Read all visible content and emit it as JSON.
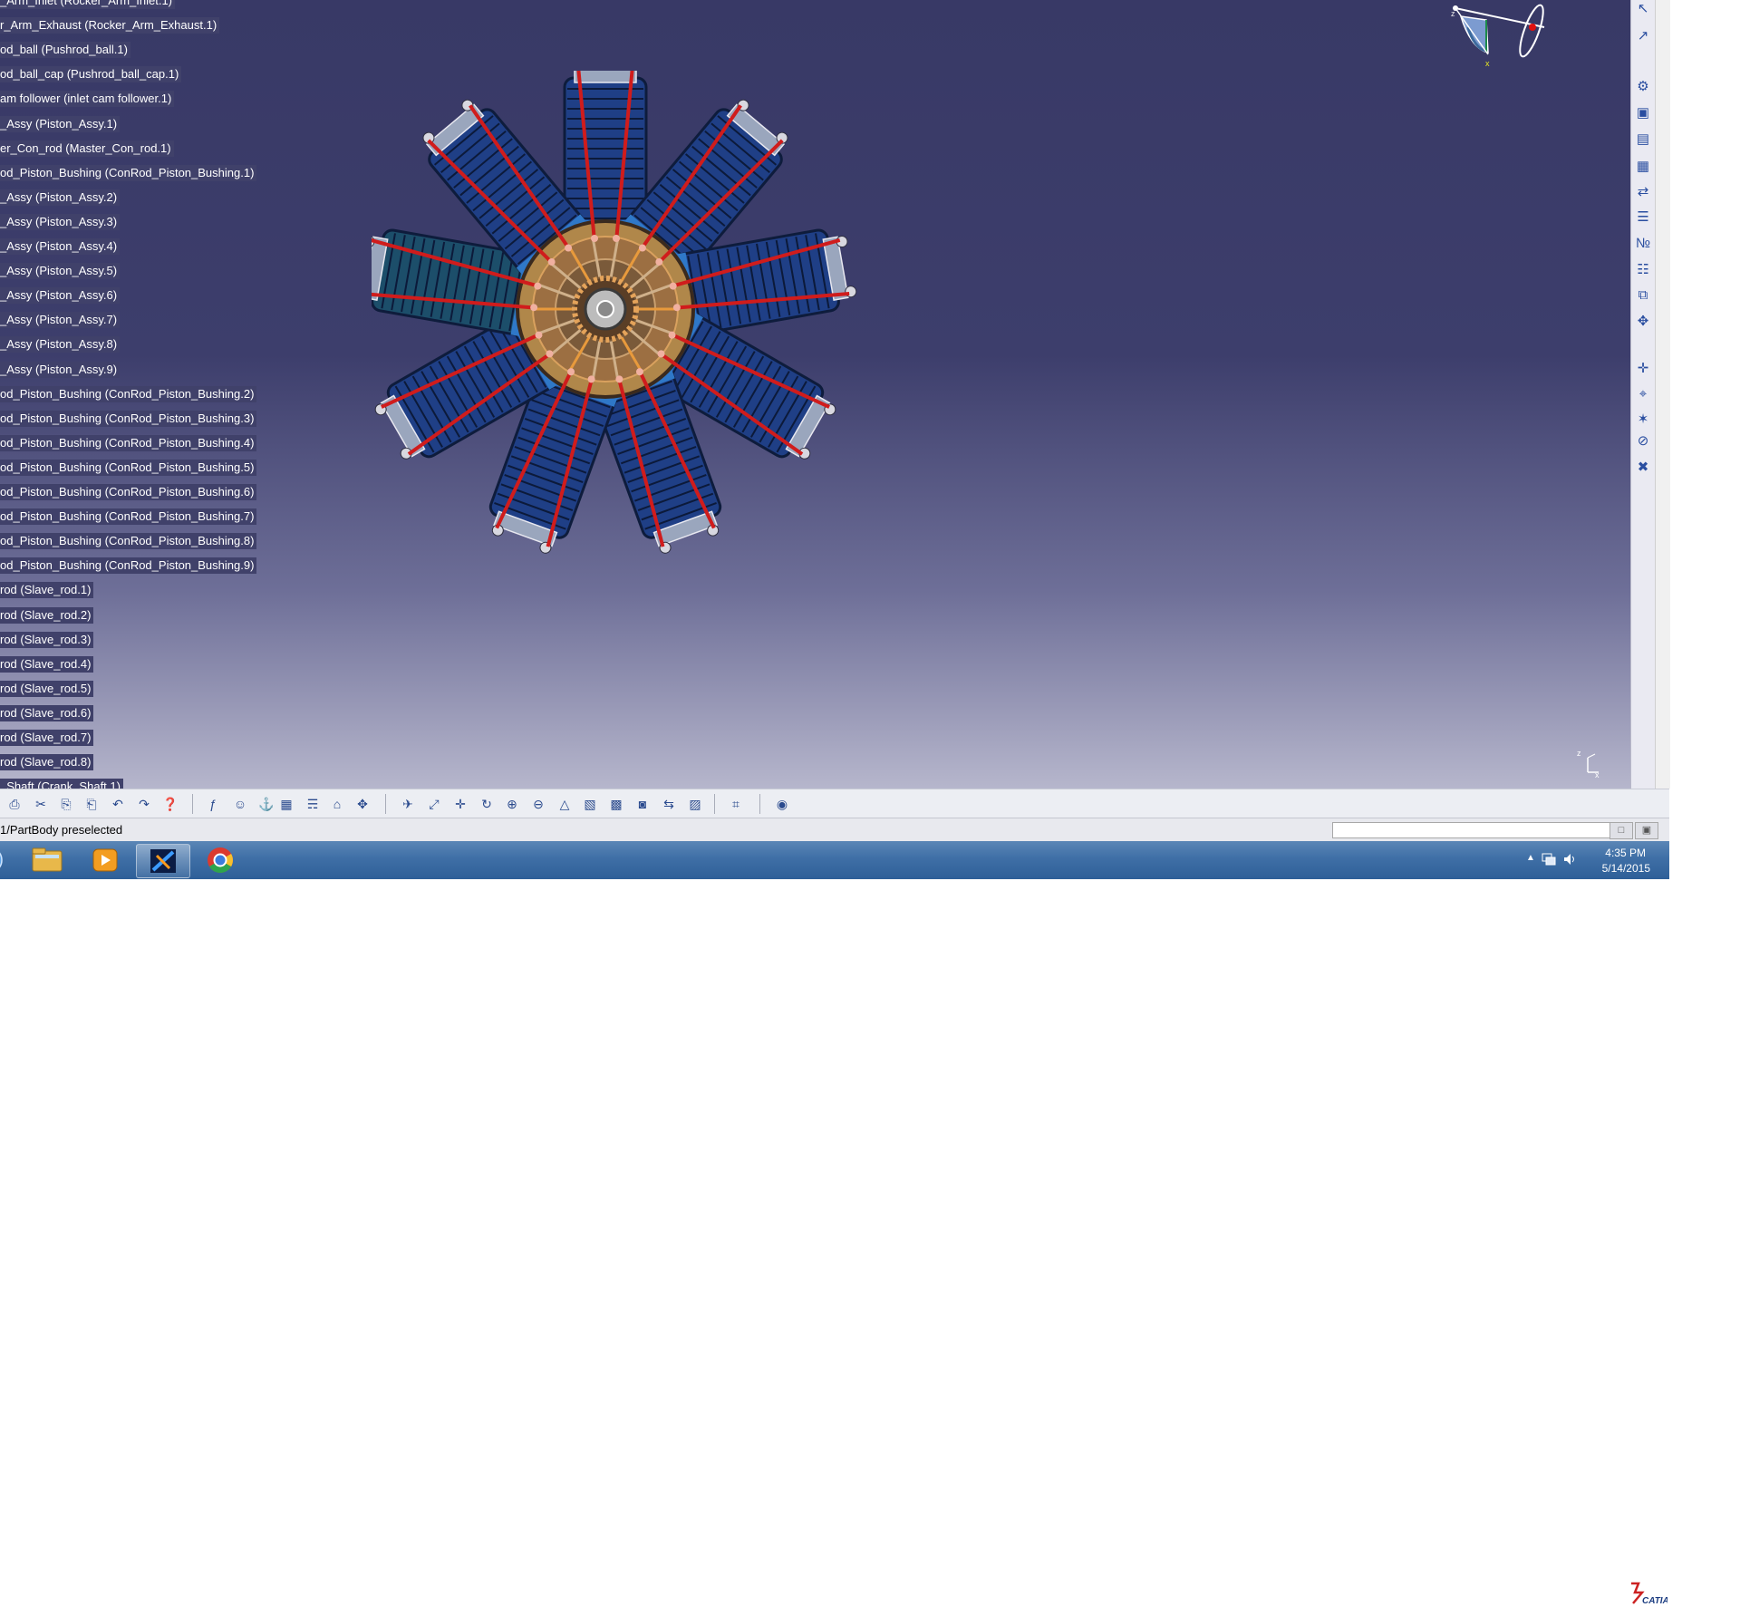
{
  "tree": {
    "items": [
      "_Arm_Inlet (Rocker_Arm_Inlet.1)",
      "r_Arm_Exhaust (Rocker_Arm_Exhaust.1)",
      "od_ball (Pushrod_ball.1)",
      "od_ball_cap (Pushrod_ball_cap.1)",
      "am follower (inlet cam follower.1)",
      "_Assy (Piston_Assy.1)",
      "er_Con_rod (Master_Con_rod.1)",
      "od_Piston_Bushing (ConRod_Piston_Bushing.1)",
      "_Assy (Piston_Assy.2)",
      "_Assy (Piston_Assy.3)",
      "_Assy (Piston_Assy.4)",
      "_Assy (Piston_Assy.5)",
      "_Assy (Piston_Assy.6)",
      "_Assy (Piston_Assy.7)",
      "_Assy (Piston_Assy.8)",
      "_Assy (Piston_Assy.9)",
      "od_Piston_Bushing (ConRod_Piston_Bushing.2)",
      "od_Piston_Bushing (ConRod_Piston_Bushing.3)",
      "od_Piston_Bushing (ConRod_Piston_Bushing.4)",
      "od_Piston_Bushing (ConRod_Piston_Bushing.5)",
      "od_Piston_Bushing (ConRod_Piston_Bushing.6)",
      "od_Piston_Bushing (ConRod_Piston_Bushing.7)",
      "od_Piston_Bushing (ConRod_Piston_Bushing.8)",
      "od_Piston_Bushing (ConRod_Piston_Bushing.9)",
      "rod (Slave_rod.1)",
      "rod (Slave_rod.2)",
      "rod (Slave_rod.3)",
      "rod (Slave_rod.4)",
      "rod (Slave_rod.5)",
      "rod (Slave_rod.6)",
      "rod (Slave_rod.7)",
      "rod (Slave_rod.8)",
      "_Shaft (Crank_Shaft.1)"
    ]
  },
  "compass": {
    "axis_z": "z",
    "axis_x": "x"
  },
  "mini_axis": {
    "z": "z",
    "x": "x"
  },
  "status": {
    "text": "1/PartBody preselected",
    "command_value": ""
  },
  "logo": {
    "text": "CATIA"
  },
  "clock": {
    "time": "4:35 PM",
    "date": "5/14/2015"
  },
  "colors": {
    "background_top": "#383966",
    "background_bottom": "#b6b6cc",
    "pushrod": "#d01c1c",
    "cylinder": "#1f3f86",
    "crankcase": "#b0874a",
    "taskbar": "#3f6fa6"
  },
  "right_toolbar": {
    "icons": [
      "select-arrow-icon",
      "select-mode-icon",
      "gear-assembly-icon",
      "product-icon",
      "part-icon",
      "existing-component-icon",
      "replace-component-icon",
      "graph-tree-reorder-icon",
      "generate-numbering-icon",
      "bill-of-material-icon",
      "multi-instantiation-icon",
      "smart-move-icon",
      "manipulation-icon",
      "snap-icon",
      "explode-icon",
      "stop-manipulate-icon",
      "clash-icon"
    ]
  },
  "bottom_toolbar": {
    "icons": [
      "print-icon",
      "cut-icon",
      "copy-icon",
      "paste-icon",
      "undo-icon",
      "redo-icon",
      "whats-this-icon",
      "formula-icon",
      "comment-icon",
      "knowledge-icon",
      "table-icon",
      "catalog-icon",
      "lock-icon",
      "publication-icon",
      "fly-mode-icon",
      "fit-all-icon",
      "pan-icon",
      "rotate-icon",
      "zoom-in-icon",
      "zoom-out-icon",
      "normal-view-icon",
      "iso-view-icon",
      "shading-icon",
      "hide-show-icon",
      "swap-visible-icon",
      "view-mode-icon",
      "grid-icon",
      "capture-icon"
    ]
  }
}
